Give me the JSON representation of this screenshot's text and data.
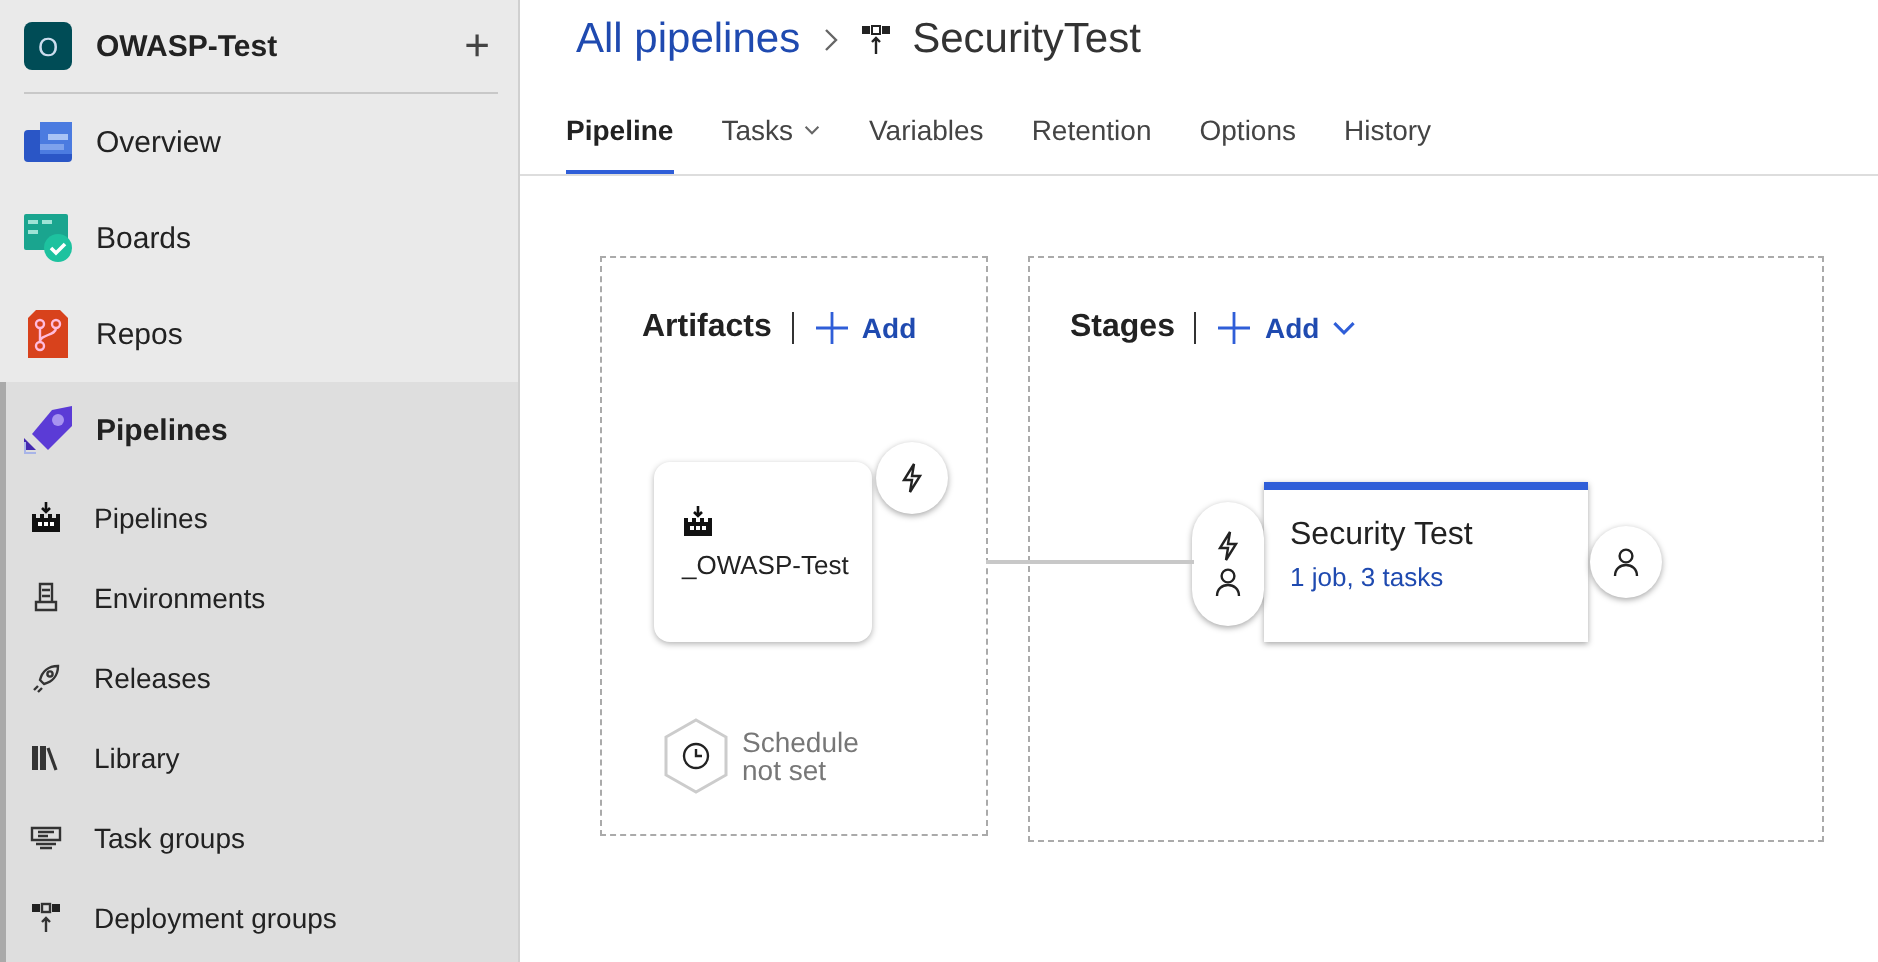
{
  "project": {
    "initial": "O",
    "name": "OWASP-Test",
    "add": "+"
  },
  "nav": [
    {
      "label": "Overview",
      "selected": false
    },
    {
      "label": "Boards",
      "selected": false
    },
    {
      "label": "Repos",
      "selected": false
    },
    {
      "label": "Pipelines",
      "selected": true,
      "children": [
        {
          "label": "Pipelines",
          "selected": false
        },
        {
          "label": "Environments",
          "selected": false
        },
        {
          "label": "Releases",
          "selected": false
        },
        {
          "label": "Library",
          "selected": false
        },
        {
          "label": "Task groups",
          "selected": false
        },
        {
          "label": "Deployment groups",
          "selected": false
        }
      ]
    }
  ],
  "breadcrumb": {
    "link": "All pipelines",
    "current": "SecurityTest"
  },
  "tabs": [
    {
      "label": "Pipeline",
      "selected": true,
      "dropdown": false
    },
    {
      "label": "Tasks",
      "selected": false,
      "dropdown": true
    },
    {
      "label": "Variables",
      "selected": false,
      "dropdown": false
    },
    {
      "label": "Retention",
      "selected": false,
      "dropdown": false
    },
    {
      "label": "Options",
      "selected": false,
      "dropdown": false
    },
    {
      "label": "History",
      "selected": false,
      "dropdown": false
    }
  ],
  "artifacts": {
    "title": "Artifacts",
    "add": "Add",
    "items": [
      {
        "name": "_OWASP-Test"
      }
    ],
    "schedule": "Schedule not set"
  },
  "stages": {
    "title": "Stages",
    "add": "Add",
    "items": [
      {
        "name": "Security Test",
        "summary": "1 job, 3 tasks"
      }
    ]
  }
}
